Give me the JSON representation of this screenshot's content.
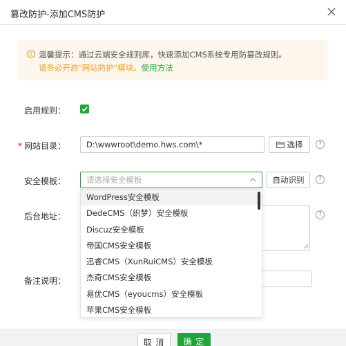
{
  "dialog": {
    "title": "篡改防护-添加CMS防护",
    "close": "×"
  },
  "alert": {
    "line1": "温馨提示：通过云端安全规则库，快速添加CMS系统专用防篡改规则。",
    "line2_text": "请务必开启\"网站防护\"模块。",
    "line2_link": "使用方法"
  },
  "form": {
    "enable_label": "启用规则：",
    "enable_checked": true,
    "required_mark": "*",
    "site_dir_label": "网站目录：",
    "site_dir_value": "D:\\wwwroot\\demo.hws.com\\*",
    "select_button": "选择",
    "template_label": "安全模板：",
    "template_placeholder": "请选择安全模板",
    "auto_detect_button": "自动识别",
    "backend_label": "后台地址：",
    "remark_label": "备注说明："
  },
  "dropdown": {
    "options": [
      "WordPress安全模板",
      "DedeCMS（织梦）安全模板",
      "Discuz安全模板",
      "帝国CMS安全模板",
      "迅睿CMS（XunRuiCMS）安全模板",
      "杰奇CMS安全模板",
      "易优CMS（eyoucms）安全模板",
      "苹果CMS安全模板"
    ]
  },
  "footer": {
    "cancel": "取 消",
    "ok": "确 定"
  },
  "colors": {
    "accent": "#20a53a",
    "warning": "#f0a020",
    "required": "#ef0808"
  }
}
